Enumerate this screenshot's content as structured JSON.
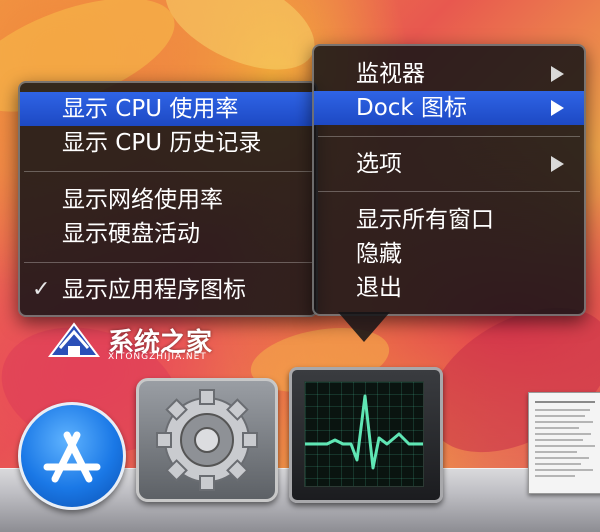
{
  "submenu": {
    "items": [
      {
        "label": "显示 CPU 使用率",
        "selected": true,
        "checked": false
      },
      {
        "label": "显示 CPU 历史记录",
        "selected": false,
        "checked": false
      },
      {
        "label": "显示网络使用率",
        "selected": false,
        "checked": false
      },
      {
        "label": "显示硬盘活动",
        "selected": false,
        "checked": false
      },
      {
        "label": "显示应用程序图标",
        "selected": false,
        "checked": true
      }
    ],
    "check_glyph": "✓"
  },
  "context_menu": {
    "items": [
      {
        "label": "监视器",
        "has_submenu": true,
        "selected": false
      },
      {
        "label": "Dock 图标",
        "has_submenu": true,
        "selected": true
      },
      {
        "label": "选项",
        "has_submenu": true,
        "selected": false
      },
      {
        "label": "显示所有窗口",
        "has_submenu": false,
        "selected": false
      },
      {
        "label": "隐藏",
        "has_submenu": false,
        "selected": false
      },
      {
        "label": "退出",
        "has_submenu": false,
        "selected": false
      }
    ]
  },
  "dock": {
    "icons": [
      {
        "name": "app-store-icon"
      },
      {
        "name": "system-preferences-icon"
      },
      {
        "name": "activity-monitor-icon"
      },
      {
        "name": "window-thumbnail"
      }
    ]
  },
  "watermark": {
    "title": "系统之家",
    "subtitle": "XITONGZHIJIA.NET"
  },
  "colors": {
    "menu_highlight": "#2455d6",
    "menu_background": "#141416"
  }
}
